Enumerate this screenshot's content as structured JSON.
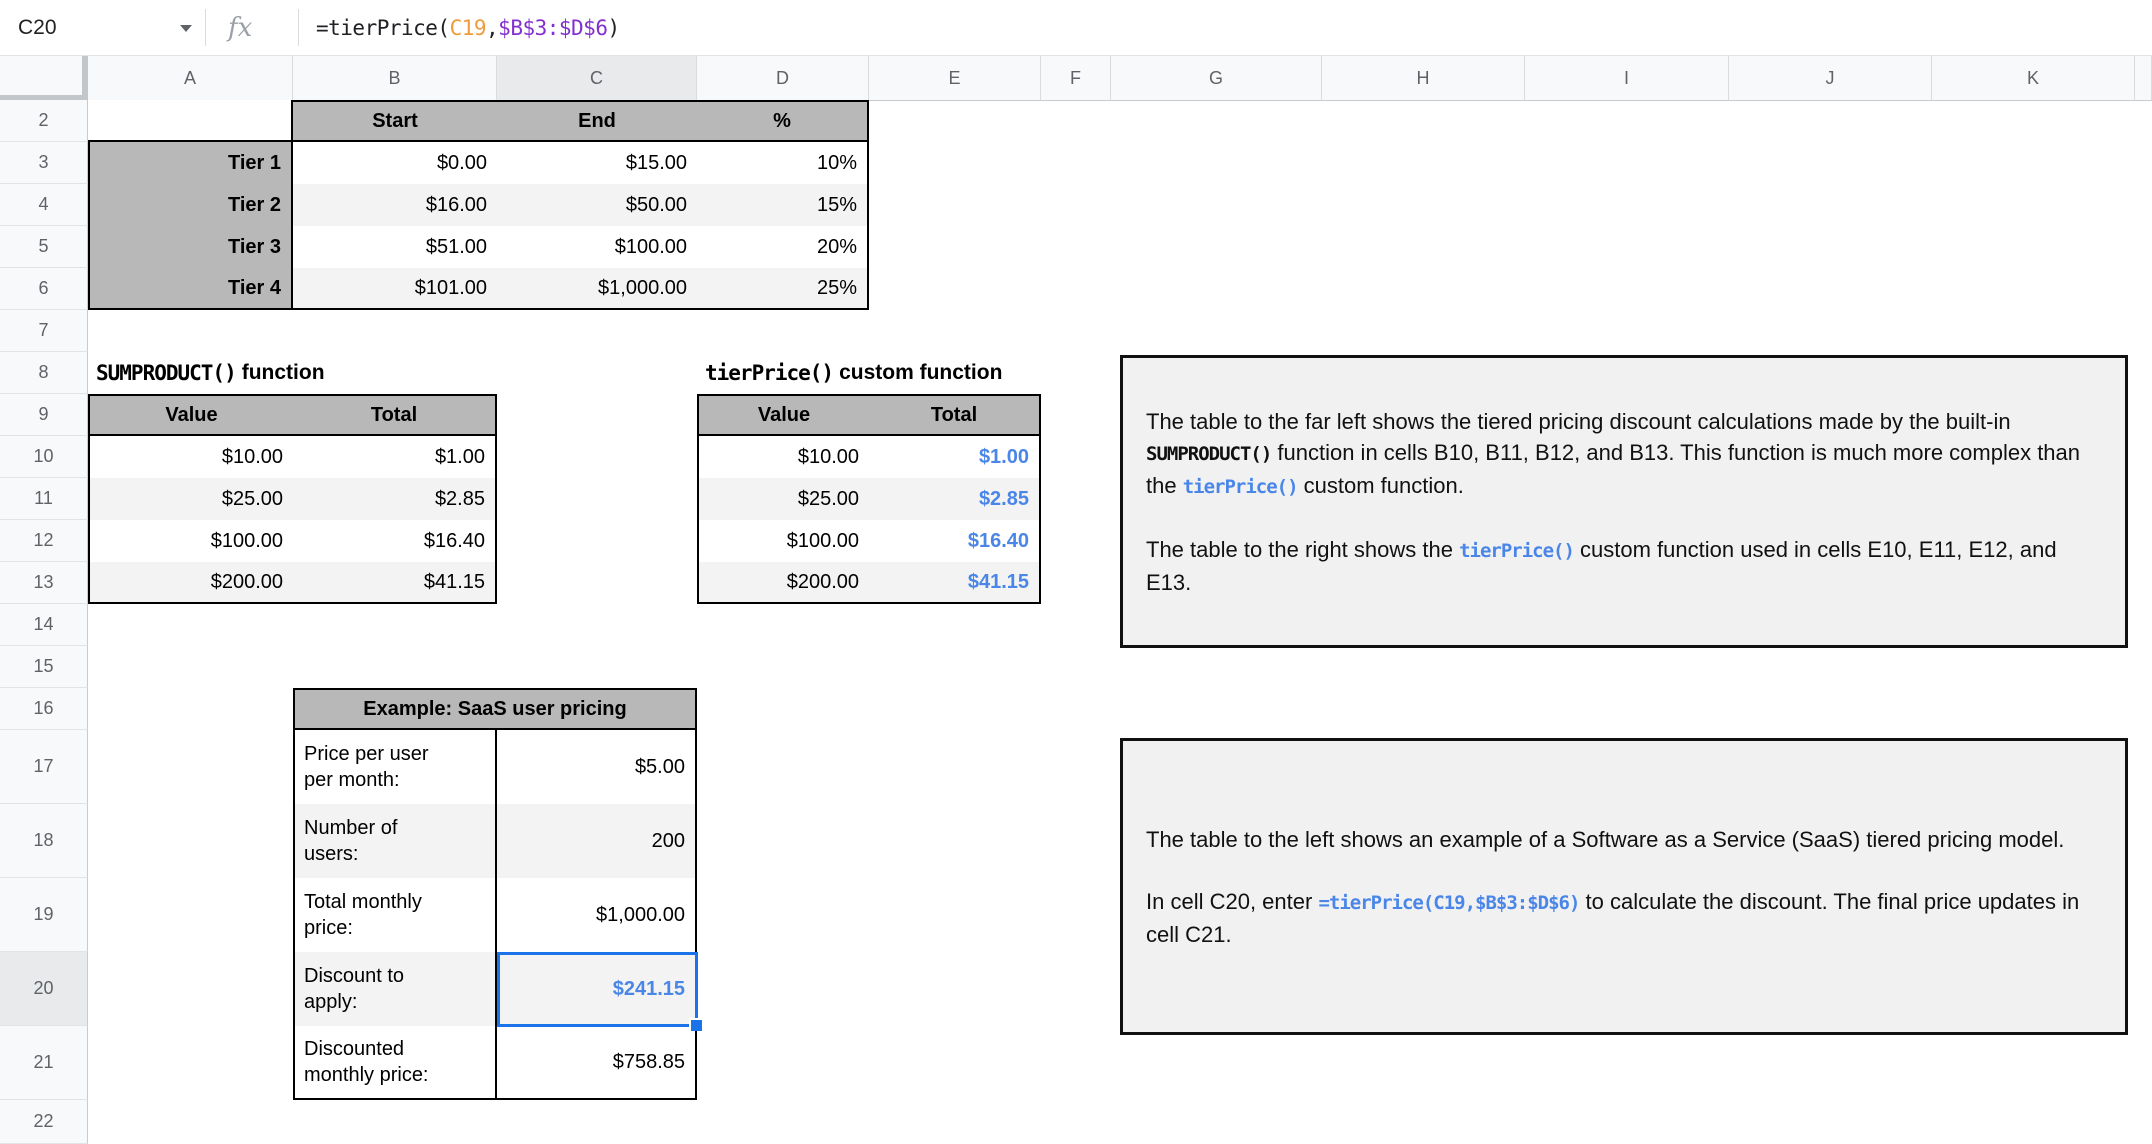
{
  "formula_bar": {
    "name_box": "C20",
    "fx_label": "fx",
    "formula_parts": [
      {
        "text": "=tierPrice(",
        "color": "#202124"
      },
      {
        "text": "C19",
        "color": "#f09b3b"
      },
      {
        "text": ",",
        "color": "#202124"
      },
      {
        "text": "$B$3:$D$6",
        "color": "#8430ce"
      },
      {
        "text": ")",
        "color": "#202124"
      }
    ]
  },
  "grid": {
    "column_headers": [
      "A",
      "B",
      "C",
      "D",
      "E",
      "F",
      "G",
      "H",
      "I",
      "J",
      "K"
    ],
    "selected_column": "C",
    "row_headers": [
      "2",
      "3",
      "4",
      "5",
      "6",
      "7",
      "8",
      "9",
      "10",
      "11",
      "12",
      "13",
      "14",
      "15",
      "16",
      "17",
      "18",
      "19",
      "20",
      "21",
      "22"
    ],
    "selected_row": "20",
    "selection_ref": "C20"
  },
  "colors": {
    "table_header_gray": "#b8b8b8",
    "row_band_gray": "#f3f3f3",
    "value_blue": "#4a86e8",
    "selection_blue": "#1a73e8"
  },
  "tier_table": {
    "headers": [
      "Start",
      "End",
      "%"
    ],
    "rows": [
      {
        "label": "Tier 1",
        "start": "$0.00",
        "end": "$15.00",
        "pct": "10%"
      },
      {
        "label": "Tier 2",
        "start": "$16.00",
        "end": "$50.00",
        "pct": "15%"
      },
      {
        "label": "Tier 3",
        "start": "$51.00",
        "end": "$100.00",
        "pct": "20%"
      },
      {
        "label": "Tier 4",
        "start": "$101.00",
        "end": "$1,000.00",
        "pct": "25%"
      }
    ]
  },
  "sumproduct_section": {
    "title_code": "SUMPRODUCT()",
    "title_rest": "function",
    "headers": [
      "Value",
      "Total"
    ],
    "rows": [
      [
        "$10.00",
        "$1.00"
      ],
      [
        "$25.00",
        "$2.85"
      ],
      [
        "$100.00",
        "$16.40"
      ],
      [
        "$200.00",
        "$41.15"
      ]
    ]
  },
  "tierprice_section": {
    "title_code": "tierPrice()",
    "title_rest": "custom function",
    "headers": [
      "Value",
      "Total"
    ],
    "rows": [
      [
        "$10.00",
        "$1.00"
      ],
      [
        "$25.00",
        "$2.85"
      ],
      [
        "$100.00",
        "$16.40"
      ],
      [
        "$200.00",
        "$41.15"
      ]
    ]
  },
  "saas_table": {
    "title": "Example: SaaS user pricing",
    "rows": [
      {
        "label": "Price per user\nper month:",
        "value": "$5.00",
        "blue": false,
        "selected": false
      },
      {
        "label": "Number of\nusers:",
        "value": "200",
        "blue": false,
        "selected": false
      },
      {
        "label": "Total monthly\nprice:",
        "value": "$1,000.00",
        "blue": false,
        "selected": false
      },
      {
        "label": "Discount to\napply:",
        "value": "$241.15",
        "blue": true,
        "selected": true
      },
      {
        "label": "Discounted\nmonthly price:",
        "value": "$758.85",
        "blue": false,
        "selected": false
      }
    ]
  },
  "note_boxes": [
    {
      "paragraphs": [
        [
          {
            "t": "The table to the far left shows the tiered pricing discount calculations made by the built-in "
          },
          {
            "t": "SUMPRODUCT()",
            "style": "code"
          },
          {
            "t": " function in cells B10, B11, B12, and B13. This function is much more complex than the "
          },
          {
            "t": "tierPrice()",
            "style": "code-blue"
          },
          {
            "t": " custom function."
          }
        ],
        [
          {
            "t": "The table to the right shows the "
          },
          {
            "t": "tierPrice()",
            "style": "code-blue"
          },
          {
            "t": " custom function used in cells E10, E11, E12, and E13."
          }
        ]
      ]
    },
    {
      "paragraphs": [
        [
          {
            "t": "The table to the left shows an example of a Software as a Service (SaaS) tiered pricing model."
          }
        ],
        [
          {
            "t": "In cell C20, enter "
          },
          {
            "t": "=tierPrice(C19,$B$3:$D$6)",
            "style": "code-blue"
          },
          {
            "t": " to calculate the discount. The final price updates in cell C21."
          }
        ]
      ]
    }
  ]
}
